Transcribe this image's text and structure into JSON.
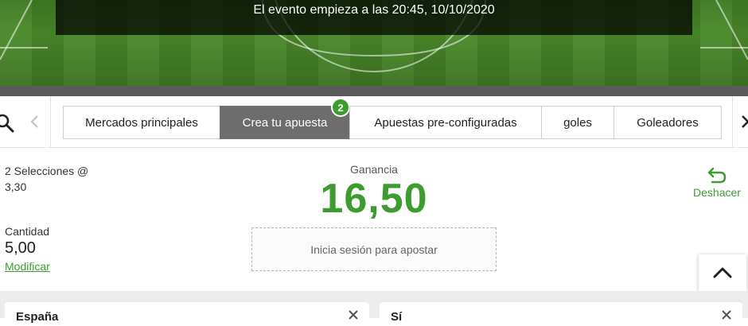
{
  "hero": {
    "event_text": "El evento empieza a las 20:45, 10/10/2020"
  },
  "nav": {
    "search_icon": "search-icon",
    "prev_icon": "chevron-left-icon",
    "close_icon": "close-icon",
    "tabs": [
      {
        "label": "Mercados principales",
        "active": false
      },
      {
        "label": "Crea tu apuesta",
        "active": true,
        "badge": "2"
      },
      {
        "label": "Apuestas pre-configuradas",
        "active": false
      },
      {
        "label": "goles",
        "active": false
      },
      {
        "label": "Goleadores",
        "active": false
      }
    ]
  },
  "bet": {
    "selections_label": "2 Selecciones @",
    "odds": "3,30",
    "gain_label": "Ganancia",
    "gain_value": "16,50",
    "amount_label": "Cantidad",
    "amount_value": "5,00",
    "modify_label": "Modificar",
    "login_button": "Inicia sesión para apostar",
    "undo_label": "Deshacer"
  },
  "selections": [
    {
      "title": "España"
    },
    {
      "title": "Sí"
    }
  ],
  "colors": {
    "accent": "#3d9c2f",
    "tab_active": "#6d6d6d"
  }
}
